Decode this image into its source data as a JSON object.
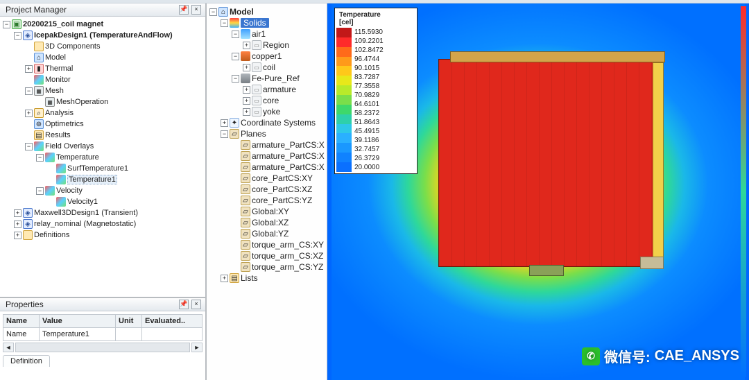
{
  "panels": {
    "project_manager_title": "Project Manager",
    "properties_title": "Properties",
    "model_title": "Model"
  },
  "project_tree": {
    "root": "20200215_coil magnet",
    "design1": "IcepakDesign1 (TemperatureAndFlow)",
    "n_3d": "3D Components",
    "n_model": "Model",
    "n_thermal": "Thermal",
    "n_monitor": "Monitor",
    "n_mesh": "Mesh",
    "n_meshop": "MeshOperation",
    "n_analysis": "Analysis",
    "n_opti": "Optimetrics",
    "n_results": "Results",
    "n_field": "Field Overlays",
    "n_temp": "Temperature",
    "n_surf": "SurfTemperature1",
    "n_temp1": "Temperature1",
    "n_velocity": "Velocity",
    "n_vel1": "Velocity1",
    "design2": "Maxwell3DDesign1 (Transient)",
    "design3": "relay_nominal (Magnetostatic)",
    "defs": "Definitions"
  },
  "properties": {
    "headers": [
      "Name",
      "Value",
      "Unit",
      "Evaluated.."
    ],
    "row": {
      "name": "Name",
      "value": "Temperature1",
      "unit": "",
      "eval": ""
    },
    "tab": "Definition"
  },
  "model_tree": {
    "solids": "Solids",
    "air1": "air1",
    "region": "Region",
    "copper1": "copper1",
    "coil": "coil",
    "fe": "Fe-Pure_Ref",
    "armature": "armature",
    "core": "core",
    "yoke": "yoke",
    "coord": "Coordinate Systems",
    "planes": "Planes",
    "plane_items": [
      "armature_PartCS:X",
      "armature_PartCS:X",
      "armature_PartCS:X",
      "core_PartCS:XY",
      "core_PartCS:XZ",
      "core_PartCS:YZ",
      "Global:XY",
      "Global:XZ",
      "Global:YZ",
      "torque_arm_CS:XY",
      "torque_arm_CS:XZ",
      "torque_arm_CS:YZ"
    ],
    "lists": "Lists"
  },
  "legend": {
    "title": "Temperature",
    "unit": "[cel]",
    "values": [
      "115.5930",
      "109.2201",
      "102.8472",
      "96.4744",
      "90.1015",
      "83.7287",
      "77.3558",
      "70.9829",
      "64.6101",
      "58.2372",
      "51.8643",
      "45.4915",
      "39.1186",
      "32.7457",
      "26.3729",
      "20.0000"
    ],
    "colors": [
      "#c21818",
      "#ff2a2a",
      "#ff6a1a",
      "#ff9a1a",
      "#ffc81a",
      "#e8e81a",
      "#b8ea2a",
      "#7ade4a",
      "#3ed86a",
      "#2ed0aa",
      "#2ec8e8",
      "#2ab0ff",
      "#1a98ff",
      "#1082ff",
      "#0a70ff"
    ]
  },
  "watermark": {
    "prefix": "微信号:",
    "id": "CAE_ANSYS"
  }
}
